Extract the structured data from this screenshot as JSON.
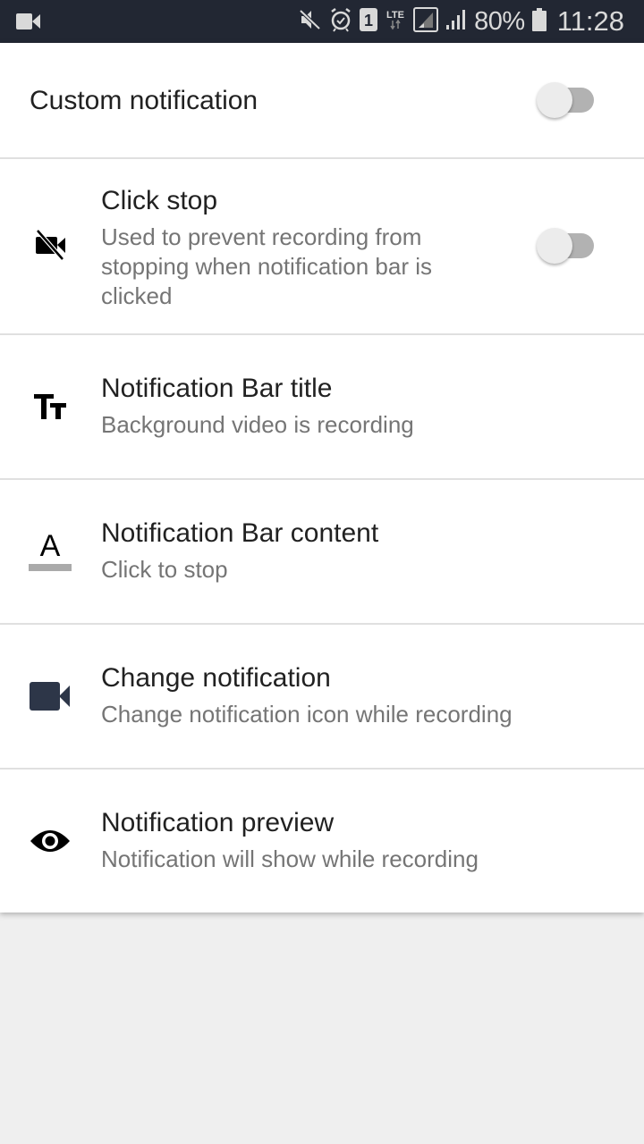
{
  "status_bar": {
    "left_icon": "videocam-icon",
    "icons": [
      "vibrate-mute-icon",
      "alarm-icon",
      "sim-1-icon",
      "lte-icon",
      "signal-sim1-icon",
      "signal-sim2-icon",
      "battery-icon"
    ],
    "network": "LTE",
    "sim": "1",
    "battery": "80%",
    "time": "11:28"
  },
  "settings": {
    "custom_notification": {
      "title": "Custom notification",
      "enabled": false
    },
    "click_stop": {
      "title": "Click stop",
      "subtitle": "Used to prevent recording from stopping when notification bar is clicked",
      "icon": "videocam-off-icon",
      "enabled": false
    },
    "bar_title": {
      "title": "Notification Bar title",
      "subtitle": "Background video is recording",
      "icon": "text-size-icon"
    },
    "bar_content": {
      "title": "Notification Bar content",
      "subtitle": "Click to stop",
      "icon": "text-format-icon",
      "icon_letter": "A"
    },
    "change_notification": {
      "title": "Change notification",
      "subtitle": "Change notification icon while recording",
      "icon": "videocam-icon"
    },
    "preview": {
      "title": "Notification preview",
      "subtitle": "Notification will show while recording",
      "icon": "eye-icon"
    }
  },
  "colors": {
    "status_bar_bg": "#222733",
    "icon_dark": "#2d3648",
    "toggle_track": "#b2b2b2",
    "toggle_thumb": "#ececec"
  }
}
